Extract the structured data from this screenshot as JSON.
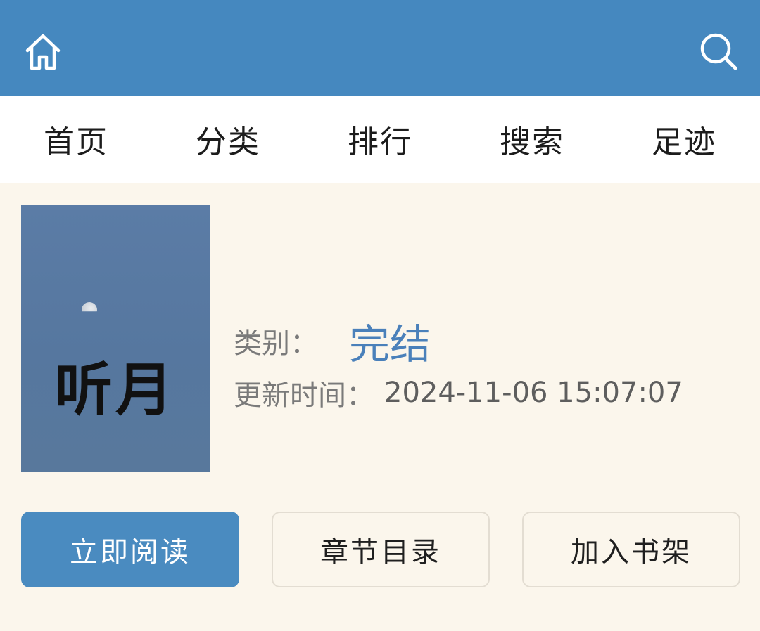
{
  "header": {
    "home_icon": "home-icon",
    "search_icon": "search-icon",
    "background_color": "#4588bf"
  },
  "nav": {
    "items": [
      {
        "label": "首页"
      },
      {
        "label": "分类"
      },
      {
        "label": "排行"
      },
      {
        "label": "搜索"
      },
      {
        "label": "足迹"
      }
    ]
  },
  "book": {
    "cover_title": "听月",
    "category_label": "类别：",
    "category_value": "完结",
    "updated_label": "更新时间：",
    "updated_value": "2024-11-06 15:07:07"
  },
  "actions": {
    "read_label": "立即阅读",
    "toc_label": "章节目录",
    "shelf_label": "加入书架"
  },
  "colors": {
    "accent": "#4a8bc0",
    "category_text": "#4a80ba",
    "page_background": "#fbf6ec"
  }
}
